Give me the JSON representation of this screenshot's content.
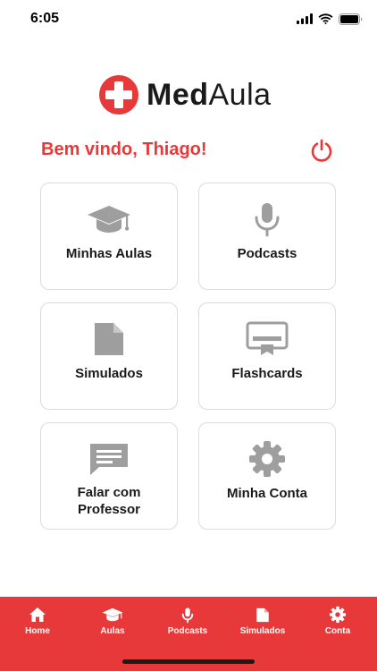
{
  "status_bar": {
    "time": "6:05"
  },
  "logo": {
    "part1": "Med",
    "part2": "Aula"
  },
  "greeting": "Bem vindo, Thiago!",
  "menu": {
    "items": [
      {
        "label": "Minhas Aulas",
        "icon": "graduation-cap-icon"
      },
      {
        "label": "Podcasts",
        "icon": "microphone-icon"
      },
      {
        "label": "Simulados",
        "icon": "document-icon"
      },
      {
        "label": "Flashcards",
        "icon": "flashcard-icon"
      },
      {
        "label": "Falar com Professor",
        "line1": "Falar com",
        "line2": "Professor",
        "icon": "chat-icon"
      },
      {
        "label": "Minha Conta",
        "icon": "gear-icon"
      }
    ]
  },
  "tab_bar": {
    "items": [
      {
        "label": "Home",
        "icon": "home-icon"
      },
      {
        "label": "Aulas",
        "icon": "graduation-cap-icon"
      },
      {
        "label": "Podcasts",
        "icon": "microphone-icon"
      },
      {
        "label": "Simulados",
        "icon": "document-icon"
      },
      {
        "label": "Conta",
        "icon": "gear-icon"
      }
    ]
  },
  "colors": {
    "accent": "#e8393a",
    "icon_gray": "#9e9e9e",
    "card_border": "#dcdcdc"
  }
}
